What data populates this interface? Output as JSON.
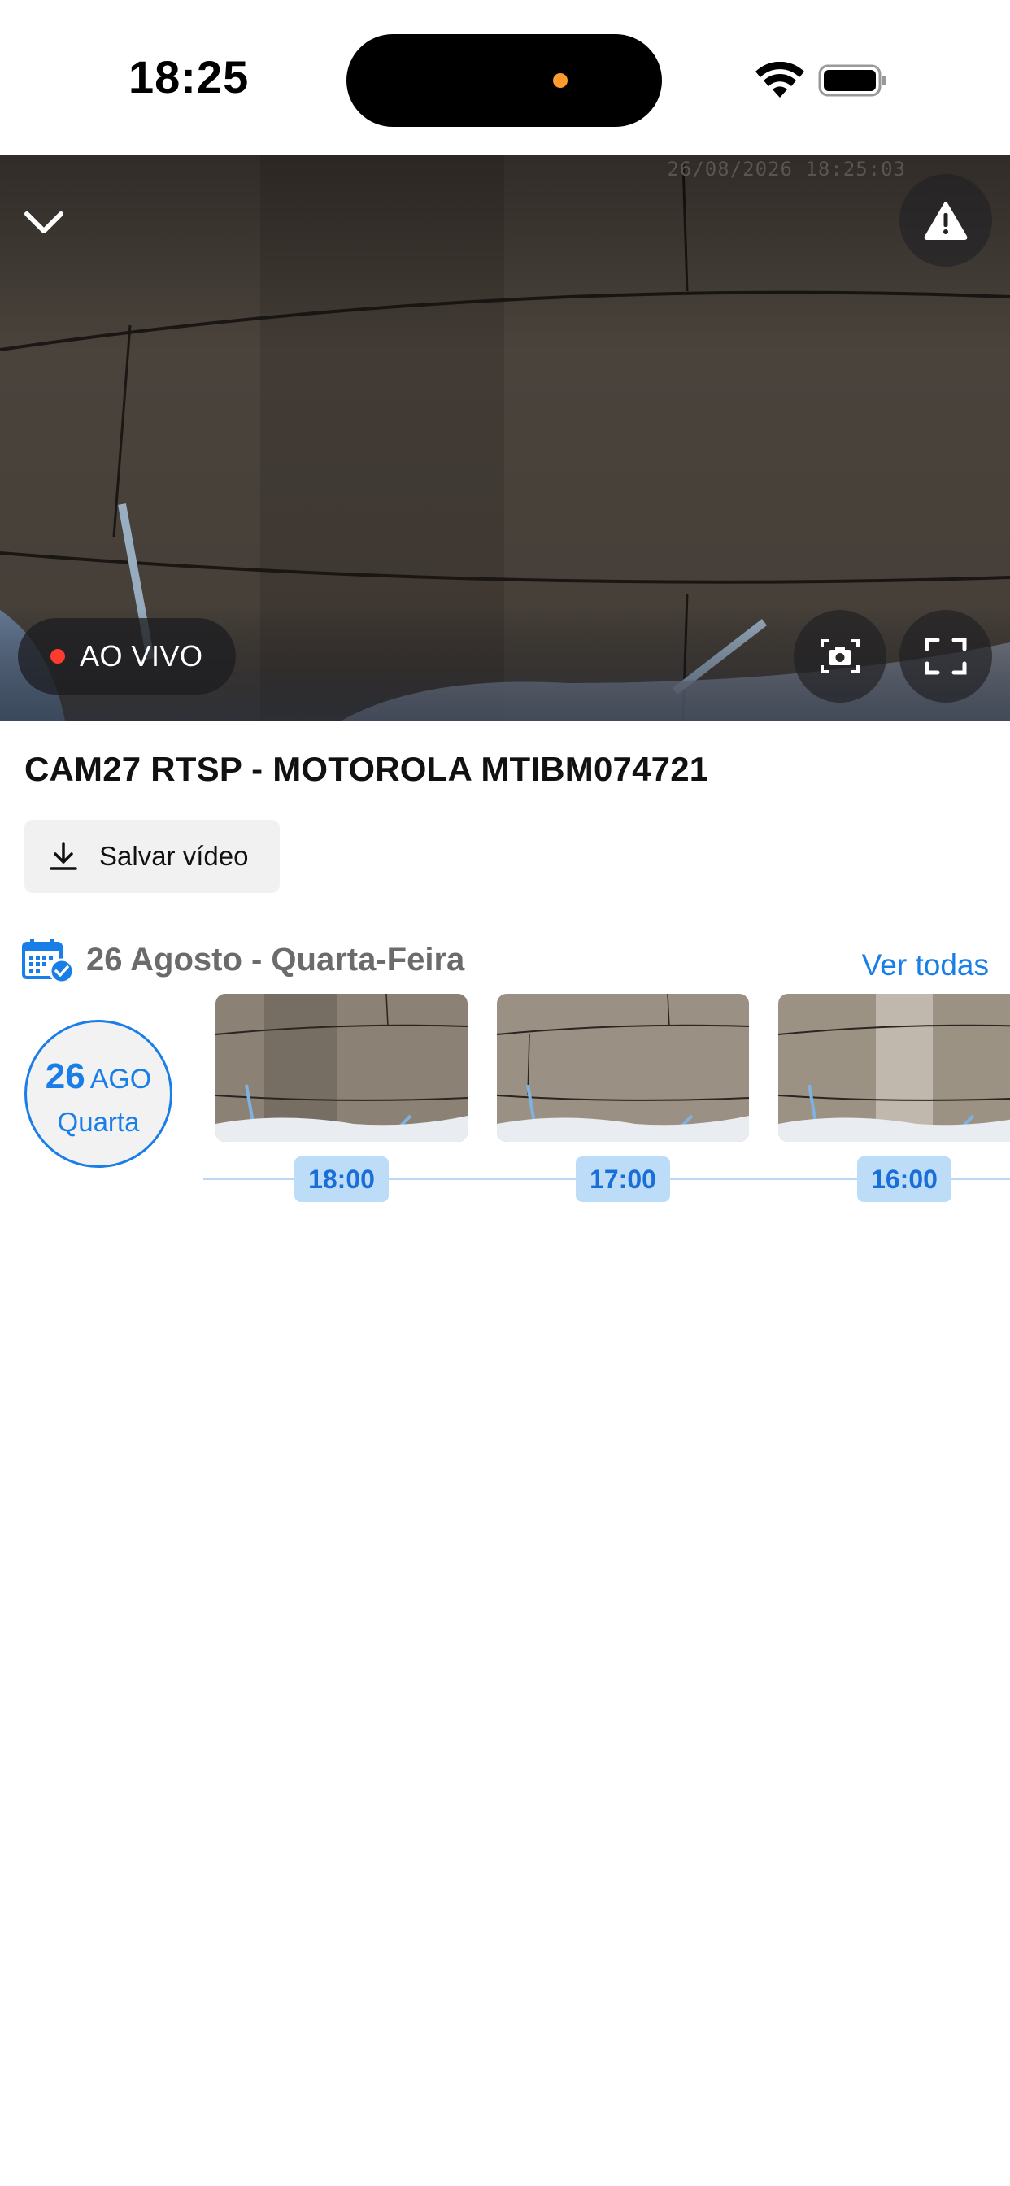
{
  "status_bar": {
    "time": "18:25"
  },
  "video": {
    "timestamp": "26/08/2026 18:25:03",
    "live_label": "AO VIVO"
  },
  "camera": {
    "title": "CAM27 RTSP - MOTOROLA MTIBM074721",
    "save_label": "Salvar vídeo"
  },
  "recordings": {
    "date_label": "26 Agosto - Quarta-Feira",
    "see_all": "Ver todas",
    "day": {
      "number": "26",
      "month": "AGO",
      "weekday": "Quarta"
    },
    "clips": [
      {
        "time": "18:00"
      },
      {
        "time": "17:00"
      },
      {
        "time": "16:00"
      }
    ]
  },
  "colors": {
    "accent": "#1a7ee8",
    "live_dot": "#ff3b30",
    "chip_bg": "#bcdcf8"
  }
}
